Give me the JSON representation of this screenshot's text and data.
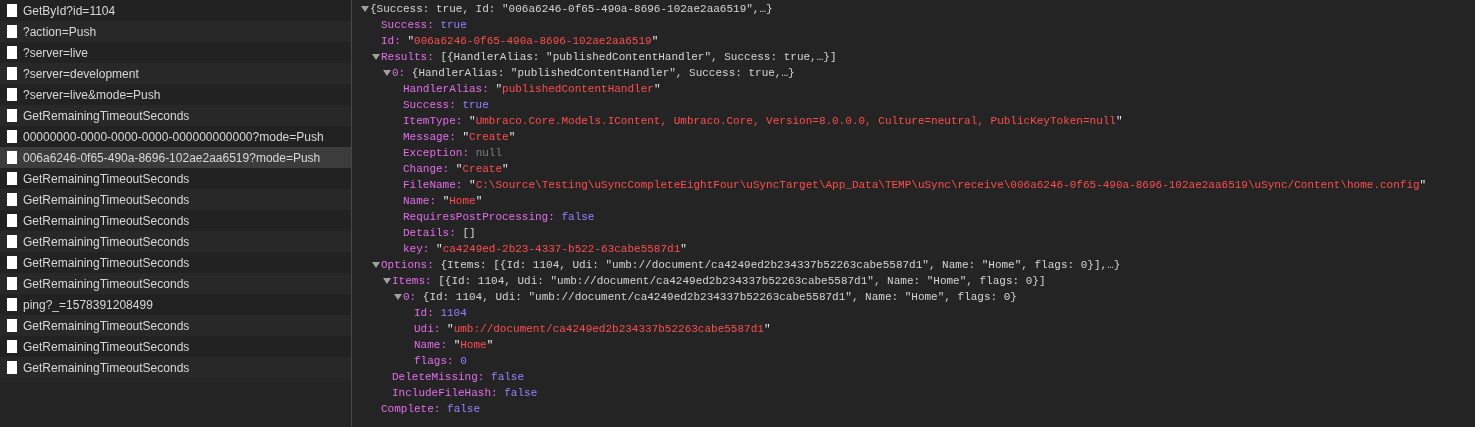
{
  "requests": [
    {
      "name": "GetById?id=1104",
      "selected": false
    },
    {
      "name": "?action=Push",
      "selected": false
    },
    {
      "name": "?server=live",
      "selected": false
    },
    {
      "name": "?server=development",
      "selected": false
    },
    {
      "name": "?server=live&mode=Push",
      "selected": false
    },
    {
      "name": "GetRemainingTimeoutSeconds",
      "selected": false
    },
    {
      "name": "00000000-0000-0000-0000-000000000000?mode=Push",
      "selected": false
    },
    {
      "name": "006a6246-0f65-490a-8696-102ae2aa6519?mode=Push",
      "selected": true
    },
    {
      "name": "GetRemainingTimeoutSeconds",
      "selected": false
    },
    {
      "name": "GetRemainingTimeoutSeconds",
      "selected": false
    },
    {
      "name": "GetRemainingTimeoutSeconds",
      "selected": false
    },
    {
      "name": "GetRemainingTimeoutSeconds",
      "selected": false
    },
    {
      "name": "GetRemainingTimeoutSeconds",
      "selected": false
    },
    {
      "name": "GetRemainingTimeoutSeconds",
      "selected": false
    },
    {
      "name": "ping?_=1578391208499",
      "selected": false
    },
    {
      "name": "GetRemainingTimeoutSeconds",
      "selected": false
    },
    {
      "name": "GetRemainingTimeoutSeconds",
      "selected": false
    },
    {
      "name": "GetRemainingTimeoutSeconds",
      "selected": false
    }
  ],
  "response": [
    {
      "kind": "summary",
      "text": "{Success: true, Id: \"006a6246-0f65-490a-8696-102ae2aa6519\",…}",
      "expanded": true,
      "children": [
        {
          "kind": "literal",
          "key": "Success:",
          "text": "true"
        },
        {
          "kind": "string",
          "key": "Id:",
          "text": "\"006a6246-0f65-490a-8696-102ae2aa6519\""
        },
        {
          "kind": "summary",
          "key": "Results:",
          "text": "[{HandlerAlias: \"publishedContentHandler\", Success: true,…}]",
          "expanded": true,
          "children": [
            {
              "kind": "summary",
              "key": "0:",
              "text": "{HandlerAlias: \"publishedContentHandler\", Success: true,…}",
              "expanded": true,
              "children": [
                {
                  "kind": "string",
                  "key": "HandlerAlias:",
                  "text": "\"publishedContentHandler\""
                },
                {
                  "kind": "literal",
                  "key": "Success:",
                  "text": "true"
                },
                {
                  "kind": "string",
                  "key": "ItemType:",
                  "text": "\"Umbraco.Core.Models.IContent, Umbraco.Core, Version=8.0.0.0, Culture=neutral, PublicKeyToken=null\""
                },
                {
                  "kind": "string",
                  "key": "Message:",
                  "text": "\"Create\""
                },
                {
                  "kind": "null",
                  "key": "Exception:",
                  "text": "null"
                },
                {
                  "kind": "string",
                  "key": "Change:",
                  "text": "\"Create\""
                },
                {
                  "kind": "string",
                  "key": "FileName:",
                  "text": "\"C:\\Source\\Testing\\uSyncCompleteEightFour\\uSyncTarget\\App_Data\\TEMP\\uSync\\receive\\006a6246-0f65-490a-8696-102ae2aa6519\\uSync/Content\\home.config\""
                },
                {
                  "kind": "string",
                  "key": "Name:",
                  "text": "\"Home\""
                },
                {
                  "kind": "literal",
                  "key": "RequiresPostProcessing:",
                  "text": "false"
                },
                {
                  "kind": "summary",
                  "key": "Details:",
                  "text": "[]"
                },
                {
                  "kind": "string",
                  "key": "key:",
                  "text": "\"ca4249ed-2b23-4337-b522-63cabe5587d1\""
                }
              ]
            }
          ]
        },
        {
          "kind": "summary",
          "key": "Options:",
          "text": "{Items: [{Id: 1104, Udi: \"umb://document/ca4249ed2b234337b52263cabe5587d1\", Name: \"Home\", flags: 0}],…}",
          "expanded": true,
          "children": [
            {
              "kind": "summary",
              "key": "Items:",
              "text": "[{Id: 1104, Udi: \"umb://document/ca4249ed2b234337b52263cabe5587d1\", Name: \"Home\", flags: 0}]",
              "expanded": true,
              "children": [
                {
                  "kind": "summary",
                  "key": "0:",
                  "text": "{Id: 1104, Udi: \"umb://document/ca4249ed2b234337b52263cabe5587d1\", Name: \"Home\", flags: 0}",
                  "expanded": true,
                  "children": [
                    {
                      "kind": "literal",
                      "key": "Id:",
                      "text": "1104"
                    },
                    {
                      "kind": "string",
                      "key": "Udi:",
                      "text": "\"umb://document/ca4249ed2b234337b52263cabe5587d1\""
                    },
                    {
                      "kind": "string",
                      "key": "Name:",
                      "text": "\"Home\""
                    },
                    {
                      "kind": "literal",
                      "key": "flags:",
                      "text": "0"
                    }
                  ]
                }
              ]
            },
            {
              "kind": "literal",
              "key": "DeleteMissing:",
              "text": "false"
            },
            {
              "kind": "literal",
              "key": "IncludeFileHash:",
              "text": "false"
            }
          ]
        },
        {
          "kind": "literal",
          "key": "Complete:",
          "text": "false"
        }
      ]
    }
  ]
}
